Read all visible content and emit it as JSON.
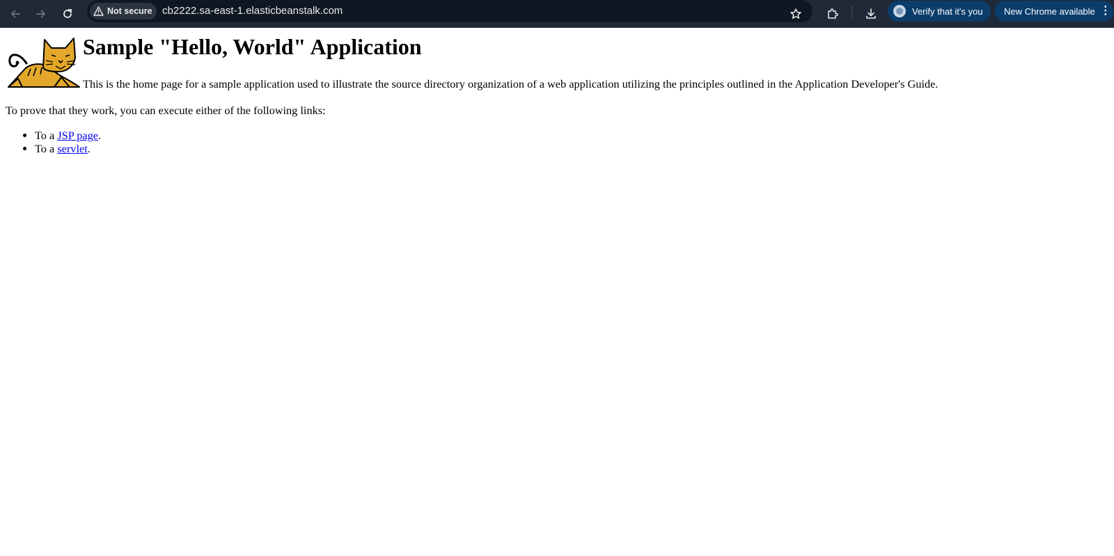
{
  "browser": {
    "security_label": "Not secure",
    "url": "cb2222.sa-east-1.elasticbeanstalk.com",
    "verify_label": "Verify that it's you",
    "update_label": "New Chrome available",
    "kebab": "⋮"
  },
  "page": {
    "title": "Sample \"Hello, World\" Application",
    "intro": "This is the home page for a sample application used to illustrate the source directory organization of a web application utilizing the principles outlined in the Application Developer's Guide.",
    "prove_text": "To prove that they work, you can execute either of the following links:",
    "links": [
      {
        "prefix": "To a ",
        "link_text": "JSP page",
        "suffix": "."
      },
      {
        "prefix": "To a ",
        "link_text": "servlet",
        "suffix": "."
      }
    ]
  },
  "colors": {
    "toolbar_bg": "#1f2937",
    "pill_bg": "#0a3d6b",
    "link": "#0000ee"
  },
  "icons": [
    "back-arrow-icon",
    "forward-arrow-icon",
    "reload-icon",
    "warning-icon",
    "star-icon",
    "extensions-icon",
    "download-icon",
    "account-avatar-icon",
    "more-vert-icon",
    "tomcat-logo"
  ]
}
